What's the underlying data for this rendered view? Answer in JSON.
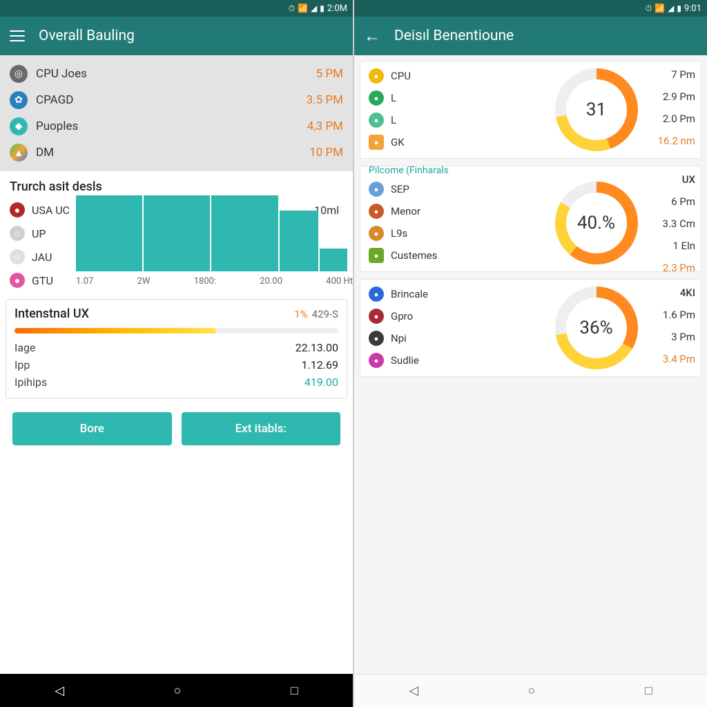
{
  "left": {
    "status": {
      "time": "2:0M"
    },
    "title": "Overall Bauling",
    "top_items": [
      {
        "icon_bg": "#6a6a6a",
        "name": "CPU Joes",
        "val": "5 PM"
      },
      {
        "icon_bg": "#2a7fbf",
        "name": "CPAGD",
        "val": "3.5 PM"
      },
      {
        "icon_bg": "#2fb8b0",
        "name": "Puoples",
        "val": "4,3 PM"
      },
      {
        "icon_bg": "#f2a33a",
        "name": "DM",
        "val": "10 PM"
      }
    ],
    "section1": "Trurch asit desls",
    "mid_items": [
      {
        "icon_bg": "#b02a2a",
        "name": "USA UC",
        "rval": "10ml"
      },
      {
        "icon_bg": "#d0d0d0",
        "name": "UP",
        "rval": ""
      },
      {
        "icon_bg": "#e0e0e0",
        "name": "JAU",
        "rval": ""
      },
      {
        "icon_bg": "#e255a0",
        "name": "GTU",
        "rval": ""
      }
    ],
    "chart_data": {
      "type": "bar",
      "categories": [
        "1.07",
        "2W",
        "1800:",
        "20.00",
        "400 Ht"
      ],
      "values": [
        100,
        100,
        100,
        80,
        30
      ],
      "ylim": [
        0,
        100
      ]
    },
    "ux": {
      "title": "Intenstnal UX",
      "pct": "1%",
      "suffix": "429-S",
      "rows": [
        {
          "l": "Iage",
          "v": "22.13.00",
          "teal": false
        },
        {
          "l": "Ipp",
          "v": "1.12.69",
          "teal": false
        },
        {
          "l": "Ipihips",
          "v": "419.00",
          "teal": true
        }
      ]
    },
    "buttons": {
      "a": "Bore",
      "b": "Ext itabls:"
    }
  },
  "right": {
    "status": {
      "time": "9:01"
    },
    "title": "Deisıl Benentioune",
    "cards": [
      {
        "label": "",
        "header_val": "",
        "center": "31",
        "donut": {
          "orange": 160,
          "yellow": 100
        },
        "items": [
          {
            "icon_bg": "#f2b90a",
            "name": "CPU"
          },
          {
            "icon_bg": "#2aa85a",
            "name": "L"
          },
          {
            "icon_bg": "#4fbf8f",
            "name": "L"
          },
          {
            "icon_bg": "#f2a33a",
            "name": "GK",
            "sq": true
          }
        ],
        "vals": [
          {
            "t": "7 Pm"
          },
          {
            "t": "2.9 Pm"
          },
          {
            "t": "2.0 Pm"
          },
          {
            "t": "16.2 nm",
            "orange": true
          }
        ]
      },
      {
        "label": "Pilcome (Finharals",
        "header_val": "UX",
        "center": "40.%",
        "donut": {
          "orange": 220,
          "yellow": 80
        },
        "items": [
          {
            "icon_bg": "#6aa0d8",
            "name": "SEP"
          },
          {
            "icon_bg": "#c85a2a",
            "name": "Menor"
          },
          {
            "icon_bg": "#d88a2a",
            "name": "L9s"
          },
          {
            "icon_bg": "#6aa82a",
            "name": "Custemes",
            "sq": true
          }
        ],
        "vals": [
          {
            "t": "6 Pm"
          },
          {
            "t": "3.3 Cm"
          },
          {
            "t": "1 Eln"
          },
          {
            "t": "2.3 Pm",
            "orange": true
          }
        ]
      },
      {
        "label": "",
        "header_val": "4KI",
        "center": "36%",
        "donut": {
          "orange": 120,
          "yellow": 140
        },
        "items": [
          {
            "icon_bg": "#2a6ad8",
            "name": "Brincale"
          },
          {
            "icon_bg": "#a82a3a",
            "name": "Gpro"
          },
          {
            "icon_bg": "#3a3a3a",
            "name": "Npi"
          },
          {
            "icon_bg": "#c83aa8",
            "name": "Sudlie"
          }
        ],
        "vals": [
          {
            "t": "1.6 Pm"
          },
          {
            "t": "3 Pm"
          },
          {
            "t": "3.4 Pm",
            "orange": true
          }
        ]
      }
    ]
  }
}
